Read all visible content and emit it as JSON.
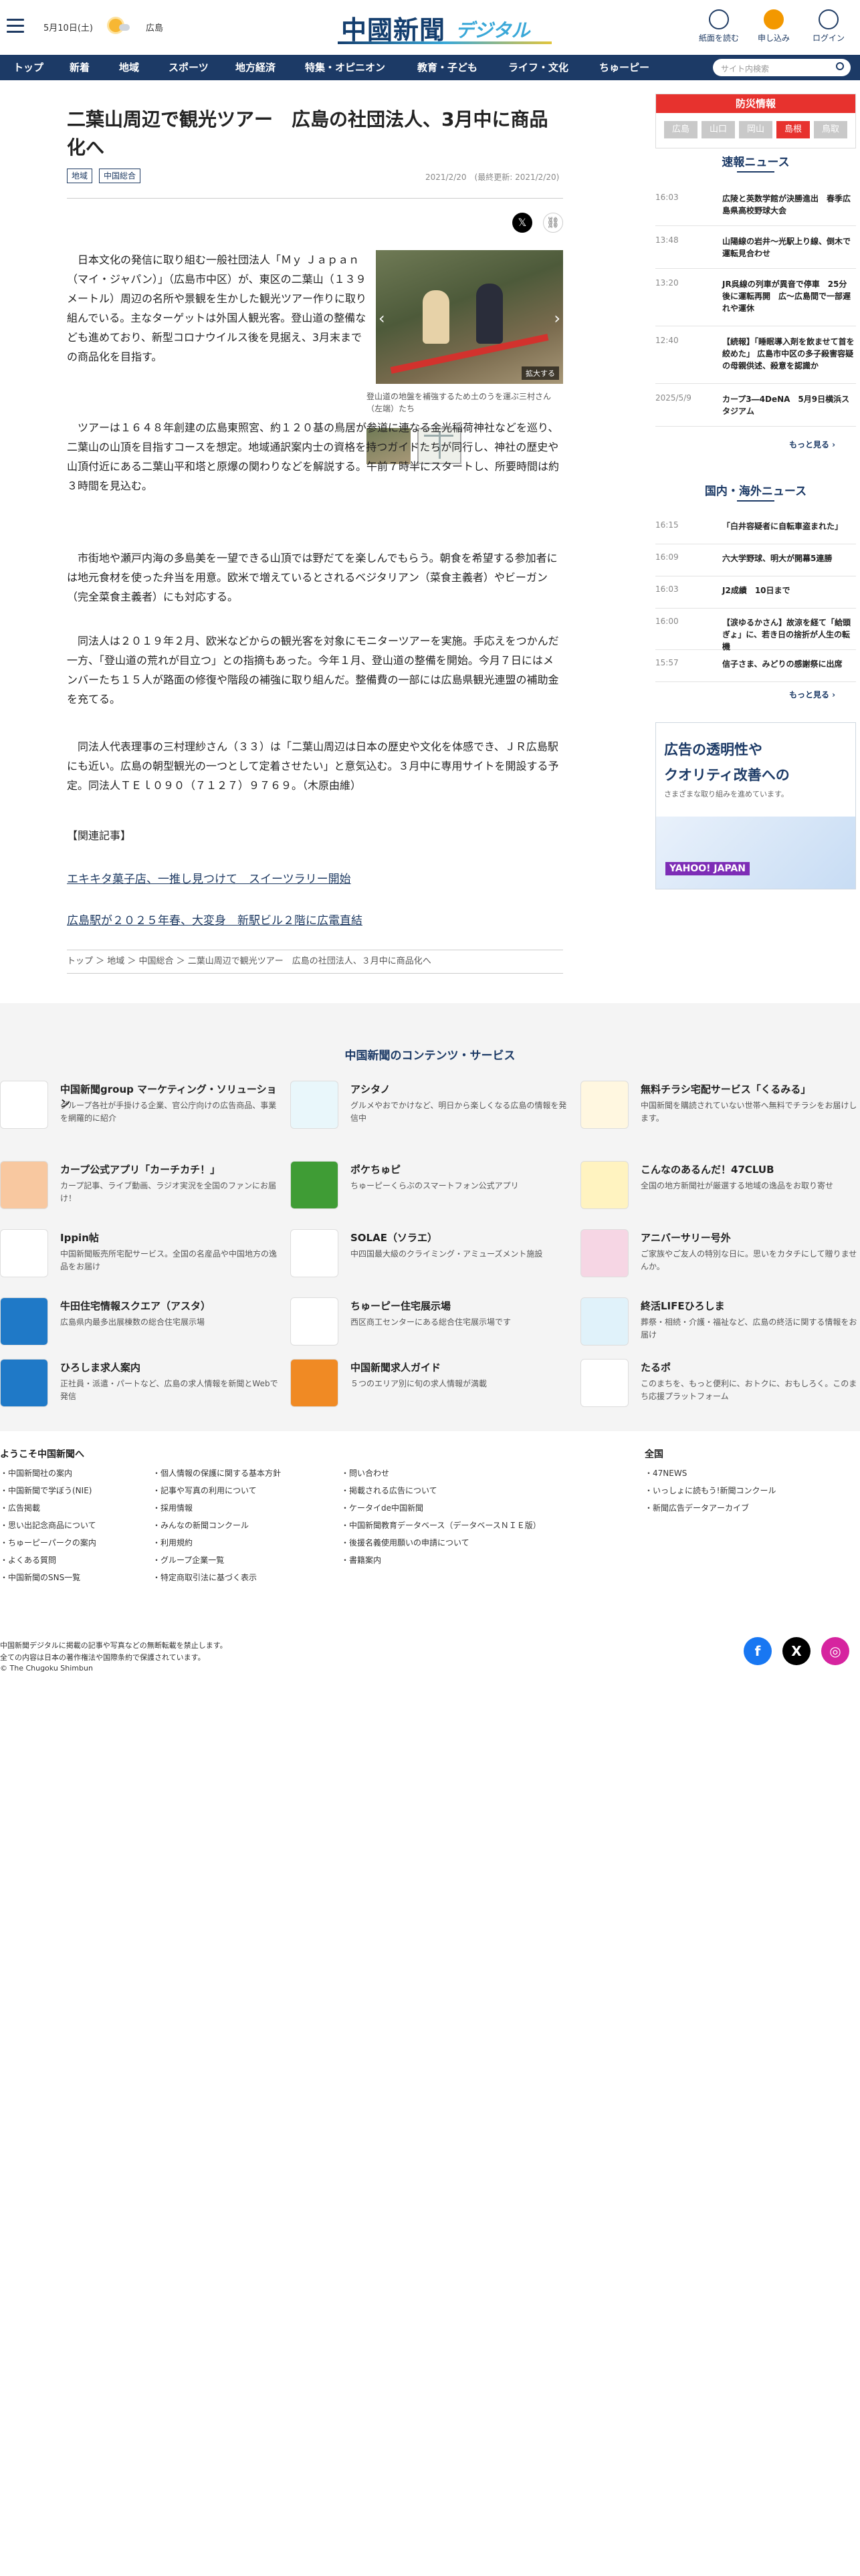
{
  "header": {
    "date": "5月10日(土)",
    "area": "広島",
    "logo_main": "中國新聞",
    "logo_sub": "デジタル",
    "btn_paper": "紙面を読む",
    "btn_subscribe": "申し込み",
    "btn_login": "ログイン"
  },
  "nav": {
    "items": [
      "トップ",
      "新着",
      "地域",
      "スポーツ",
      "地方経済",
      "特集・オピニオン",
      "教育・子ども",
      "ライフ・文化",
      "ちゅーピー"
    ],
    "search_placeholder": "サイト内検索"
  },
  "article": {
    "title": "二葉山周辺で観光ツアー　広島の社団法人、3月中に商品化へ",
    "tags": [
      "地域",
      "中国総合"
    ],
    "date": "2021/2/20　(最終更新: 2021/2/20)",
    "p1": "日本文化の発信に取り組む一般社団法人「Ｍｙ Ｊａｐａｎ（マイ・ジャパン）」（広島市中区）が、東区の二葉山（１３９メートル）周辺の名所や景観を生かした観光ツアー作りに取り組んでいる。主なターゲットは外国人観光客。登山道の整備なども進めており、新型コロナウイルス後を見据え、3月末までの商品化を目指す。",
    "p2": "ツアーは１６４８年創建の広島東照宮、約１２０基の鳥居が参道に連なる金光稲荷神社などを巡り、二葉山の山頂を目指すコースを想定。地域通訳案内士の資格を持つガイドたちが同行し、神社の歴史や山頂付近にある二葉山平和塔と原爆の関わりなどを解説する。午前７時半にスタートし、所要時間は約３時間を見込む。",
    "p3": "市街地や瀬戸内海の多島美を一望できる山頂では野だてを楽しんでもらう。朝食を希望する参加者には地元食材を使った弁当を用意。欧米で増えているとされるベジタリアン（菜食主義者）やビーガン（完全菜食主義者）にも対応する。",
    "p4": "同法人は２０１９年２月、欧米などからの観光客を対象にモニターツアーを実施。手応えをつかんだ一方、「登山道の荒れが目立つ」との指摘もあった。今年１月、登山道の整備を開始。今月７日にはメンバーたち１５人が路面の修復や階段の補強に取り組んだ。整備費の一部には広島県観光連盟の補助金を充てる。",
    "p5": "同法人代表理事の三村理紗さん（３３）は「二葉山周辺は日本の歴史や文化を体感でき、ＪＲ広島駅にも近い。広島の朝型観光の一つとして定着させたい」と意気込む。３月中に専用サイトを開設する予定。同法人ＴＥｌ０９０（７１２７）９７６９。（木原由維）",
    "photo_zoom": "拡大する",
    "photo_caption": "登山道の地盤を補強するため土のうを運ぶ三村さん（左端）たち",
    "related_head": "【関連記事】",
    "related": [
      "エキキタ菓子店、一推し見つけて　スイーツラリー開始",
      "広島駅が２０２５年春、大変身　新駅ビル２階に広電直結"
    ],
    "breadcrumb": "トップ ＞ 地域 ＞ 中国総合 ＞ 二葉山周辺で観光ツアー　広島の社団法人、３月中に商品化へ"
  },
  "sidebar": {
    "disaster_title": "防災情報",
    "prefs": [
      "広島",
      "山口",
      "岡山",
      "島根",
      "鳥取"
    ],
    "active_pref": "島根",
    "breaking_title": "速報ニュース",
    "breaking": [
      {
        "time": "16:03",
        "text": "広陵と英数学館が決勝進出　春季広島県高校野球大会"
      },
      {
        "time": "13:48",
        "text": "山陽線の岩井～光駅上り線、倒木で運転見合わせ"
      },
      {
        "time": "13:20",
        "text": "JR呉線の列車が異音で停車　25分後に運転再開　広～広島間で一部遅れや運休"
      },
      {
        "time": "12:40",
        "text": "【続報】「睡眠導入剤を飲ませて首を絞めた」 広島市中区の多子殺害容疑の母親供述、殺意を認識か"
      },
      {
        "time": "2025/5/9",
        "text": "カープ3―4DeNA　5月9日横浜スタジアム"
      }
    ],
    "more": "もっと見る ›",
    "domestic_title": "国内・海外ニュース",
    "domestic": [
      {
        "time": "16:15",
        "text": "「白井容疑者に自転車盗まれた」"
      },
      {
        "time": "16:09",
        "text": "六大学野球、明大が開幕5連勝"
      },
      {
        "time": "16:03",
        "text": "J2成績　10日まで"
      },
      {
        "time": "16:00",
        "text": "【涙ゆるかさん】故涼を経て「給頭ぎょ」に、若き日の捨折が人生の転機"
      },
      {
        "time": "15:57",
        "text": "信子さま、みどりの感謝祭に出席"
      }
    ],
    "ad_line1": "広告の透明性や",
    "ad_line2": "クオリティ改善への",
    "ad_line3": "さまざまな取り組みを進めています。",
    "ad_brand": "YAHOO! JAPAN"
  },
  "services": {
    "title": "中国新聞のコンテンツ・サービス",
    "items": [
      {
        "name": "中国新聞group マーケティング・ソリューション",
        "desc": "グループ各社が手掛ける企業、官公庁向けの広告商品、事業を網羅的に紹介",
        "color": "#ffffff"
      },
      {
        "name": "アシタノ",
        "desc": "グルメやおでかけなど、明日から楽しくなる広島の情報を発信中",
        "color": "#e9f7fb"
      },
      {
        "name": "無料チラシ宅配サービス「くるみる」",
        "desc": "中国新聞を購読されていない世帯へ無料でチラシをお届けします。",
        "color": "#fff7e0"
      },
      {
        "name": "カープ公式アプリ「カーチカチ！」",
        "desc": "カープ記事、ライブ動画、ラジオ実況を全国のファンにお届け！",
        "color": "#f8c8a0"
      },
      {
        "name": "ポケちゅピ",
        "desc": "ちゅーピーくらぶのスマートフォン公式アプリ",
        "color": "#3f9c35"
      },
      {
        "name": "こんなのあるんだ！47CLUB",
        "desc": "全国の地方新聞社が厳選する地域の逸品をお取り寄せ",
        "color": "#fff3c0"
      },
      {
        "name": "Ippin帖",
        "desc": "中国新聞販売所宅配サービス。全国の名産品や中国地方の逸品をお届け",
        "color": "#ffffff"
      },
      {
        "name": "SOLAE（ソラエ）",
        "desc": "中四国最大級のクライミング・アミューズメント施設",
        "color": "#ffffff"
      },
      {
        "name": "アニバーサリー号外",
        "desc": "ご家族やご友人の特別な日に。思いをカタチにして贈りませんか。",
        "color": "#f6d6e4"
      },
      {
        "name": "牛田住宅情報スクエア（アスタ）",
        "desc": "広島県内最多出展棟数の総合住宅展示場",
        "color": "#1f79c7"
      },
      {
        "name": "ちゅーピー住宅展示場",
        "desc": "西区商工センターにある総合住宅展示場です",
        "color": "#ffffff"
      },
      {
        "name": "終活LIFEひろしま",
        "desc": "葬祭・相続・介護・福祉など、広島の終活に関する情報をお届け",
        "color": "#e0f2fa"
      },
      {
        "name": "ひろしま求人案内",
        "desc": "正社員・派遣・パートなど、広島の求人情報を新聞とWebで発信",
        "color": "#1f79c7"
      },
      {
        "name": "中国新聞求人ガイド",
        "desc": "５つのエリア別に旬の求人情報が満載",
        "color": "#f08a24"
      },
      {
        "name": "たるポ",
        "desc": "このまちを、もっと便利に、おトクに、おもしろく。このまち応援プラットフォーム",
        "color": "#ffffff"
      }
    ]
  },
  "footer": {
    "welcome": "ようこそ中国新聞へ",
    "col1": [
      "中国新聞社の案内",
      "中国新聞で学ぼう(NIE)",
      "広告掲載",
      "思い出記念商品について",
      "ちゅーピーパークの案内",
      "よくある質問",
      "中国新聞のSNS一覧"
    ],
    "col2": [
      "個人情報の保護に関する基本方針",
      "記事や写真の利用について",
      "採用情報",
      "みんなの新聞コンクール",
      "利用規約",
      "グループ企業一覧",
      "特定商取引法に基づく表示"
    ],
    "col3": [
      "問い合わせ",
      "掲載される広告について",
      "ケータイde中国新聞",
      "中国新聞教育データベース（データベースＮＩＥ版）",
      "後援名義使用願いの申請について",
      "書籍案内"
    ],
    "national": "全国",
    "col4": [
      "47NEWS",
      "いっしょに読もう!新聞コンクール",
      "新聞広告データアーカイブ"
    ],
    "copy1": "中国新聞デジタルに掲載の記事や写真などの無断転載を禁止します。",
    "copy2": "全ての内容は日本の著作権法や国際条約で保護されています。",
    "copy3": "© The Chugoku Shimbun",
    "social": [
      "f",
      "X",
      "◎"
    ]
  }
}
